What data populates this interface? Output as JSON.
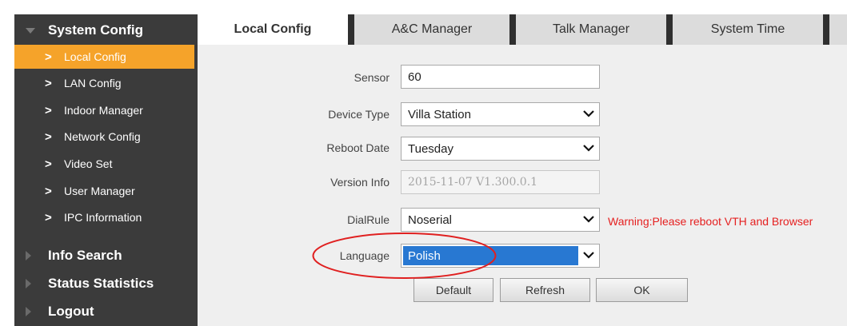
{
  "sidebar": {
    "group_system": "System Config",
    "items": [
      {
        "label": "Local Config"
      },
      {
        "label": "LAN Config"
      },
      {
        "label": "Indoor Manager"
      },
      {
        "label": "Network Config"
      },
      {
        "label": "Video Set"
      },
      {
        "label": "User Manager"
      },
      {
        "label": "IPC Information"
      }
    ],
    "group_info": "Info Search",
    "group_status": "Status Statistics",
    "group_logout": "Logout",
    "chevron": ">"
  },
  "tabs": [
    {
      "label": "Local Config"
    },
    {
      "label": "A&C Manager"
    },
    {
      "label": "Talk Manager"
    },
    {
      "label": "System Time"
    }
  ],
  "form": {
    "sensor_label": "Sensor",
    "sensor_value": "60",
    "device_type_label": "Device Type",
    "device_type_value": "Villa Station",
    "reboot_label": "Reboot Date",
    "reboot_value": "Tuesday",
    "version_label": "Version Info",
    "version_value": "2015-11-07 V1.300.0.1",
    "dialrule_label": "DialRule",
    "dialrule_value": "Noserial",
    "warning": "Warning:Please reboot VTH and Browser",
    "language_label": "Language",
    "language_value": "Polish"
  },
  "buttons": {
    "default": "Default",
    "refresh": "Refresh",
    "ok": "OK"
  },
  "colors": {
    "sidebar_bg": "#3b3b3b",
    "active_item": "#f5a32a",
    "warning": "#e52020",
    "highlight": "#2878d2",
    "annotation_circle": "#e02020"
  }
}
